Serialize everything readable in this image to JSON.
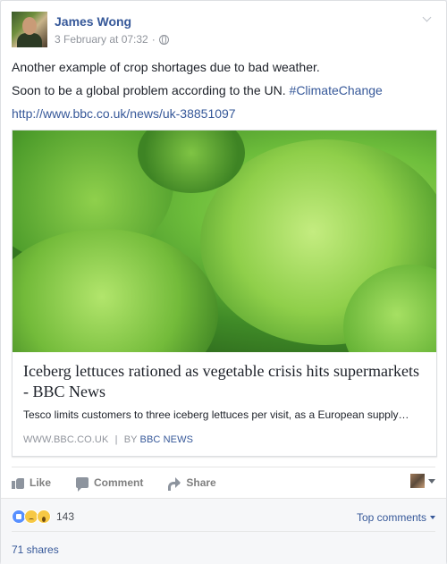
{
  "post": {
    "author": "James Wong",
    "date": "3 February at 07:32",
    "date_separator": "·",
    "text_lines": [
      "Another example of crop shortages due to bad weather.",
      "Soon to be a global problem according to the UN. "
    ],
    "hashtag": "#ClimateChange",
    "url": "http://www.bbc.co.uk/news/uk-38851097"
  },
  "link_card": {
    "title": "Iceberg lettuces rationed as vegetable crisis hits supermarkets - BBC News",
    "description": "Tesco limits customers to three iceberg lettuces per visit, as a European supply…",
    "domain": "WWW.BBC.CO.UK",
    "separator": "|",
    "by_label": "BY",
    "by_name": "BBC NEWS"
  },
  "actions": {
    "like": "Like",
    "comment": "Comment",
    "share": "Share"
  },
  "reactions": {
    "types": [
      "like",
      "sad",
      "wow"
    ],
    "count": "143",
    "sort_label": "Top comments"
  },
  "shares": "71 shares",
  "colors": {
    "link": "#365899",
    "muted": "#90949c",
    "like_blue": "#5890ff",
    "emoji_yellow": "#f7c844"
  }
}
